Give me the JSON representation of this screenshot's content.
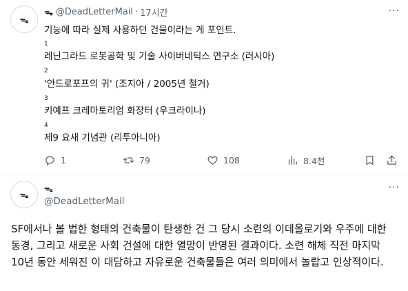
{
  "tweet1": {
    "avatar_symbol": "ᯓ",
    "name_symbol": "ᯓ",
    "handle": "@DeadLetterMail",
    "separator": "·",
    "time": "17시간",
    "more": "···",
    "intro": "기능에 따라 실제 사용하던 건물이라는 게 포인트.",
    "items": [
      {
        "number": "1",
        "text": "레닌그라드 로봇공학 및 기술 사이버네틱스 연구소 (러시아)"
      },
      {
        "number": "2",
        "text": "'안드로포프의 귀' (조지아 / 2005년 철거)"
      },
      {
        "number": "3",
        "text": "키예프 크레마토리엄 화장터 (우크라이나)"
      },
      {
        "number": "4",
        "text": "제9 요새 기념관 (리투아니아)"
      }
    ],
    "actions": {
      "replies": "1",
      "reposts": "79",
      "likes": "108",
      "views": "8.4천"
    }
  },
  "tweet2": {
    "avatar_symbol": "ᯓ",
    "name_symbol": "ᯓ",
    "handle": "@DeadLetterMail",
    "more": "···",
    "body": "SF에서나 볼 법한 형태의 건축물이 탄생한 건 그 당시 소련의 이데올로기와 우주에 대한 동경, 그리고 새로운 사회 건설에 대한 열망이 반영된 결과이다. 소련 해체 직전 마지막 10년 동안 세워진 이 대담하고 자유로운 건축물들은 여러 의미에서 놀랍고 인상적이다."
  },
  "colors": {
    "text": "#0f1419",
    "secondary": "#536471",
    "border": "#eff3f4"
  }
}
